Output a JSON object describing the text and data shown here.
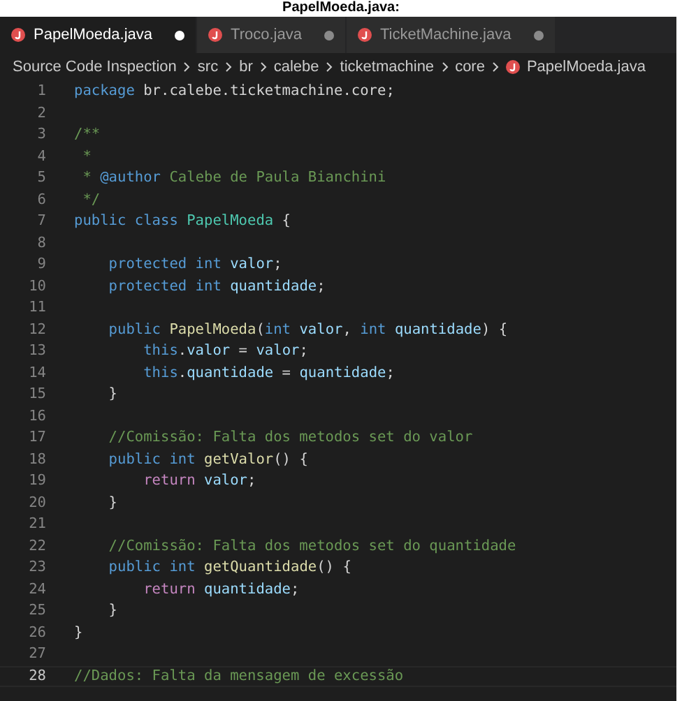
{
  "caption": "PapelMoeda.java:",
  "tabs": [
    {
      "label": "PapelMoeda.java",
      "selected": true,
      "modified": true
    },
    {
      "label": "Troco.java",
      "selected": false,
      "modified": true
    },
    {
      "label": "TicketMachine.java",
      "selected": false,
      "modified": true
    }
  ],
  "breadcrumb": [
    "Source Code Inspection",
    "src",
    "br",
    "calebe",
    "ticketmachine",
    "core",
    "PapelMoeda.java"
  ],
  "lines": [
    {
      "number": "1",
      "current": false,
      "tokens": [
        {
          "text": "package ",
          "kind": "kw"
        },
        {
          "text": "br.calebe.ticketmachine.core;",
          "kind": "plain"
        }
      ]
    },
    {
      "number": "2",
      "current": false
    },
    {
      "number": "3",
      "current": false,
      "tokens": [
        {
          "text": "/**",
          "kind": "comment"
        }
      ]
    },
    {
      "number": "4",
      "current": false,
      "tokens": [
        {
          "text": " *",
          "kind": "comment"
        }
      ]
    },
    {
      "number": "5",
      "current": false,
      "tokens": [
        {
          "text": " * ",
          "kind": "comment"
        },
        {
          "text": "@author",
          "kind": "kw"
        },
        {
          "text": " Calebe de Paula Bianchini",
          "kind": "comment"
        }
      ]
    },
    {
      "number": "6",
      "current": false,
      "tokens": [
        {
          "text": " */",
          "kind": "comment"
        }
      ]
    },
    {
      "number": "7",
      "current": false,
      "tokens": [
        {
          "text": "public class ",
          "kind": "kw"
        },
        {
          "text": "PapelMoeda",
          "kind": "type"
        },
        {
          "text": " {",
          "kind": "plain"
        }
      ]
    },
    {
      "number": "8",
      "current": false
    },
    {
      "number": "9",
      "current": false,
      "tokens": [
        {
          "text": "    protected int ",
          "kind": "kw"
        },
        {
          "text": "valor",
          "kind": "var"
        },
        {
          "text": ";",
          "kind": "plain"
        }
      ]
    },
    {
      "number": "10",
      "current": false,
      "tokens": [
        {
          "text": "    protected int ",
          "kind": "kw"
        },
        {
          "text": "quantidade",
          "kind": "var"
        },
        {
          "text": ";",
          "kind": "plain"
        }
      ]
    },
    {
      "number": "11",
      "current": false
    },
    {
      "number": "12",
      "current": false,
      "tokens": [
        {
          "text": "    public ",
          "kind": "kw"
        },
        {
          "text": "PapelMoeda",
          "kind": "func"
        },
        {
          "text": "(",
          "kind": "plain"
        },
        {
          "text": "int ",
          "kind": "kw"
        },
        {
          "text": "valor",
          "kind": "var"
        },
        {
          "text": ", ",
          "kind": "plain"
        },
        {
          "text": "int ",
          "kind": "kw"
        },
        {
          "text": "quantidade",
          "kind": "var"
        },
        {
          "text": ") {",
          "kind": "plain"
        }
      ]
    },
    {
      "number": "13",
      "current": false,
      "tokens": [
        {
          "text": "        this",
          "kind": "kw"
        },
        {
          "text": ".",
          "kind": "plain"
        },
        {
          "text": "valor",
          "kind": "var"
        },
        {
          "text": " = ",
          "kind": "plain"
        },
        {
          "text": "valor",
          "kind": "var"
        },
        {
          "text": ";",
          "kind": "plain"
        }
      ]
    },
    {
      "number": "14",
      "current": false,
      "tokens": [
        {
          "text": "        this",
          "kind": "kw"
        },
        {
          "text": ".",
          "kind": "plain"
        },
        {
          "text": "quantidade",
          "kind": "var"
        },
        {
          "text": " = ",
          "kind": "plain"
        },
        {
          "text": "quantidade",
          "kind": "var"
        },
        {
          "text": ";",
          "kind": "plain"
        }
      ]
    },
    {
      "number": "15",
      "current": false,
      "tokens": [
        {
          "text": "    }",
          "kind": "plain"
        }
      ]
    },
    {
      "number": "16",
      "current": false
    },
    {
      "number": "17",
      "current": false,
      "tokens": [
        {
          "text": "    //Comissão: Falta dos metodos set do valor",
          "kind": "comment"
        }
      ]
    },
    {
      "number": "18",
      "current": false,
      "tokens": [
        {
          "text": "    public int ",
          "kind": "kw"
        },
        {
          "text": "getValor",
          "kind": "func"
        },
        {
          "text": "() {",
          "kind": "plain"
        }
      ]
    },
    {
      "number": "19",
      "current": false,
      "tokens": [
        {
          "text": "        return ",
          "kind": "ctrl"
        },
        {
          "text": "valor",
          "kind": "var"
        },
        {
          "text": ";",
          "kind": "plain"
        }
      ]
    },
    {
      "number": "20",
      "current": false,
      "tokens": [
        {
          "text": "    }",
          "kind": "plain"
        }
      ]
    },
    {
      "number": "21",
      "current": false
    },
    {
      "number": "22",
      "current": false,
      "tokens": [
        {
          "text": "    //Comissão: Falta dos metodos set do quantidade",
          "kind": "comment"
        }
      ]
    },
    {
      "number": "23",
      "current": false,
      "tokens": [
        {
          "text": "    public int ",
          "kind": "kw"
        },
        {
          "text": "getQuantidade",
          "kind": "func"
        },
        {
          "text": "() {",
          "kind": "plain"
        }
      ]
    },
    {
      "number": "24",
      "current": false,
      "tokens": [
        {
          "text": "        return ",
          "kind": "ctrl"
        },
        {
          "text": "quantidade",
          "kind": "var"
        },
        {
          "text": ";",
          "kind": "plain"
        }
      ]
    },
    {
      "number": "25",
      "current": false,
      "tokens": [
        {
          "text": "    }",
          "kind": "plain"
        }
      ]
    },
    {
      "number": "26",
      "current": false,
      "tokens": [
        {
          "text": "}",
          "kind": "plain"
        }
      ]
    },
    {
      "number": "27",
      "current": false
    },
    {
      "number": "28",
      "current": true,
      "tokens": [
        {
          "text": "//Dados: Falta da mensagem de excessão",
          "kind": "comment"
        }
      ]
    }
  ]
}
